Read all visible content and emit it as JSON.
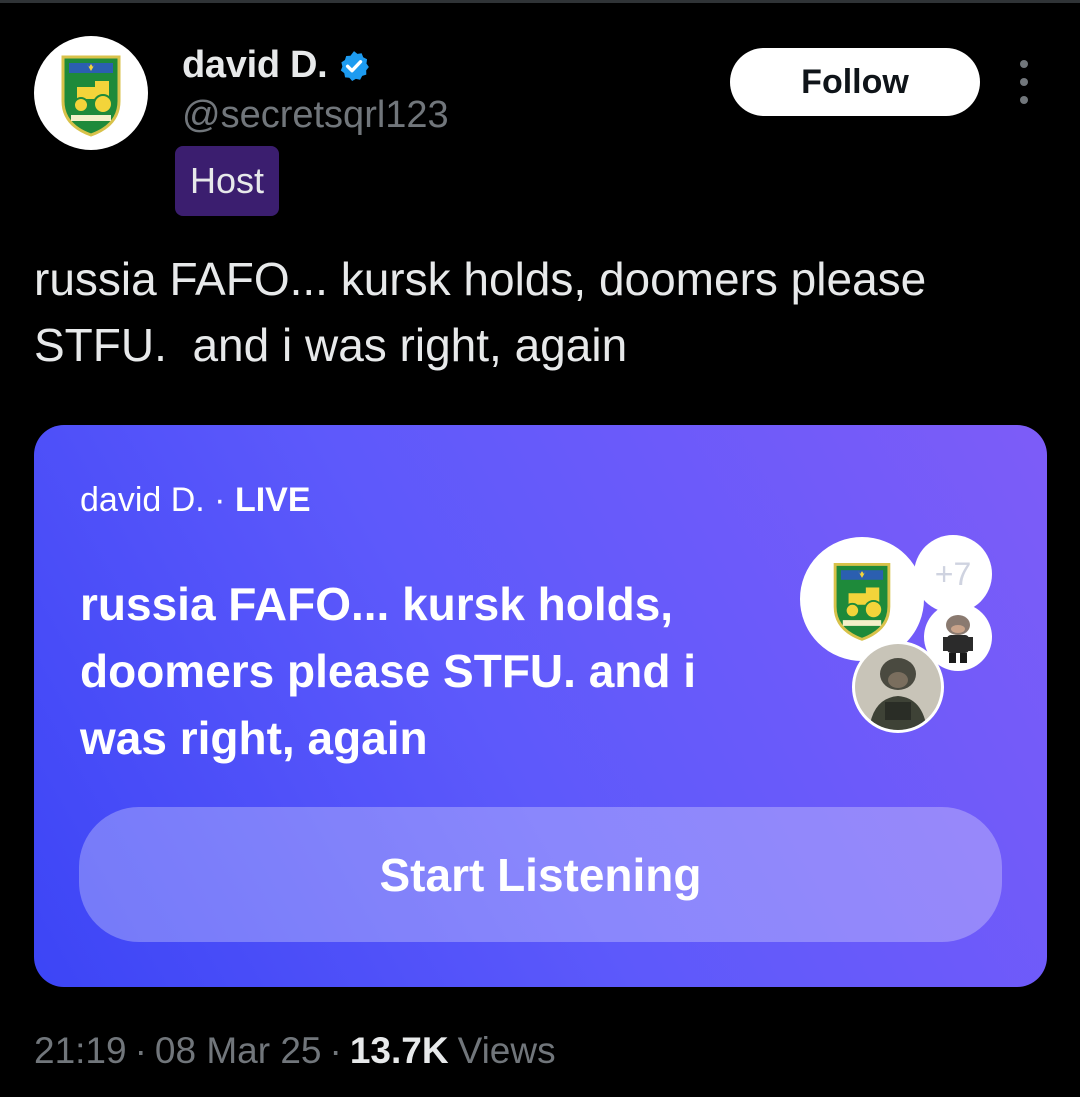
{
  "author": {
    "display_name": "david D.",
    "handle": "@secretsqrl123",
    "role_badge": "Host",
    "verified": true,
    "verified_color": "#1d9bf0"
  },
  "actions": {
    "follow_label": "Follow",
    "more_icon": "more-vertical-icon"
  },
  "tweet": {
    "text": "russia FAFO... kursk holds, doomers please STFU.  and i was right, again"
  },
  "space": {
    "host_name": "david D.",
    "separator": " · ",
    "status": "LIVE",
    "title": "russia FAFO... kursk holds, doomers please STFU.  and i was right, again",
    "extra_listeners": "+7",
    "listen_label": "Start Listening",
    "gradient_start": "#3c45f6",
    "gradient_end": "#7d5cf8"
  },
  "meta": {
    "time": "21:19",
    "date": "08 Mar 25",
    "views_count": "13.7K",
    "views_label": "Views",
    "separator": "·"
  }
}
